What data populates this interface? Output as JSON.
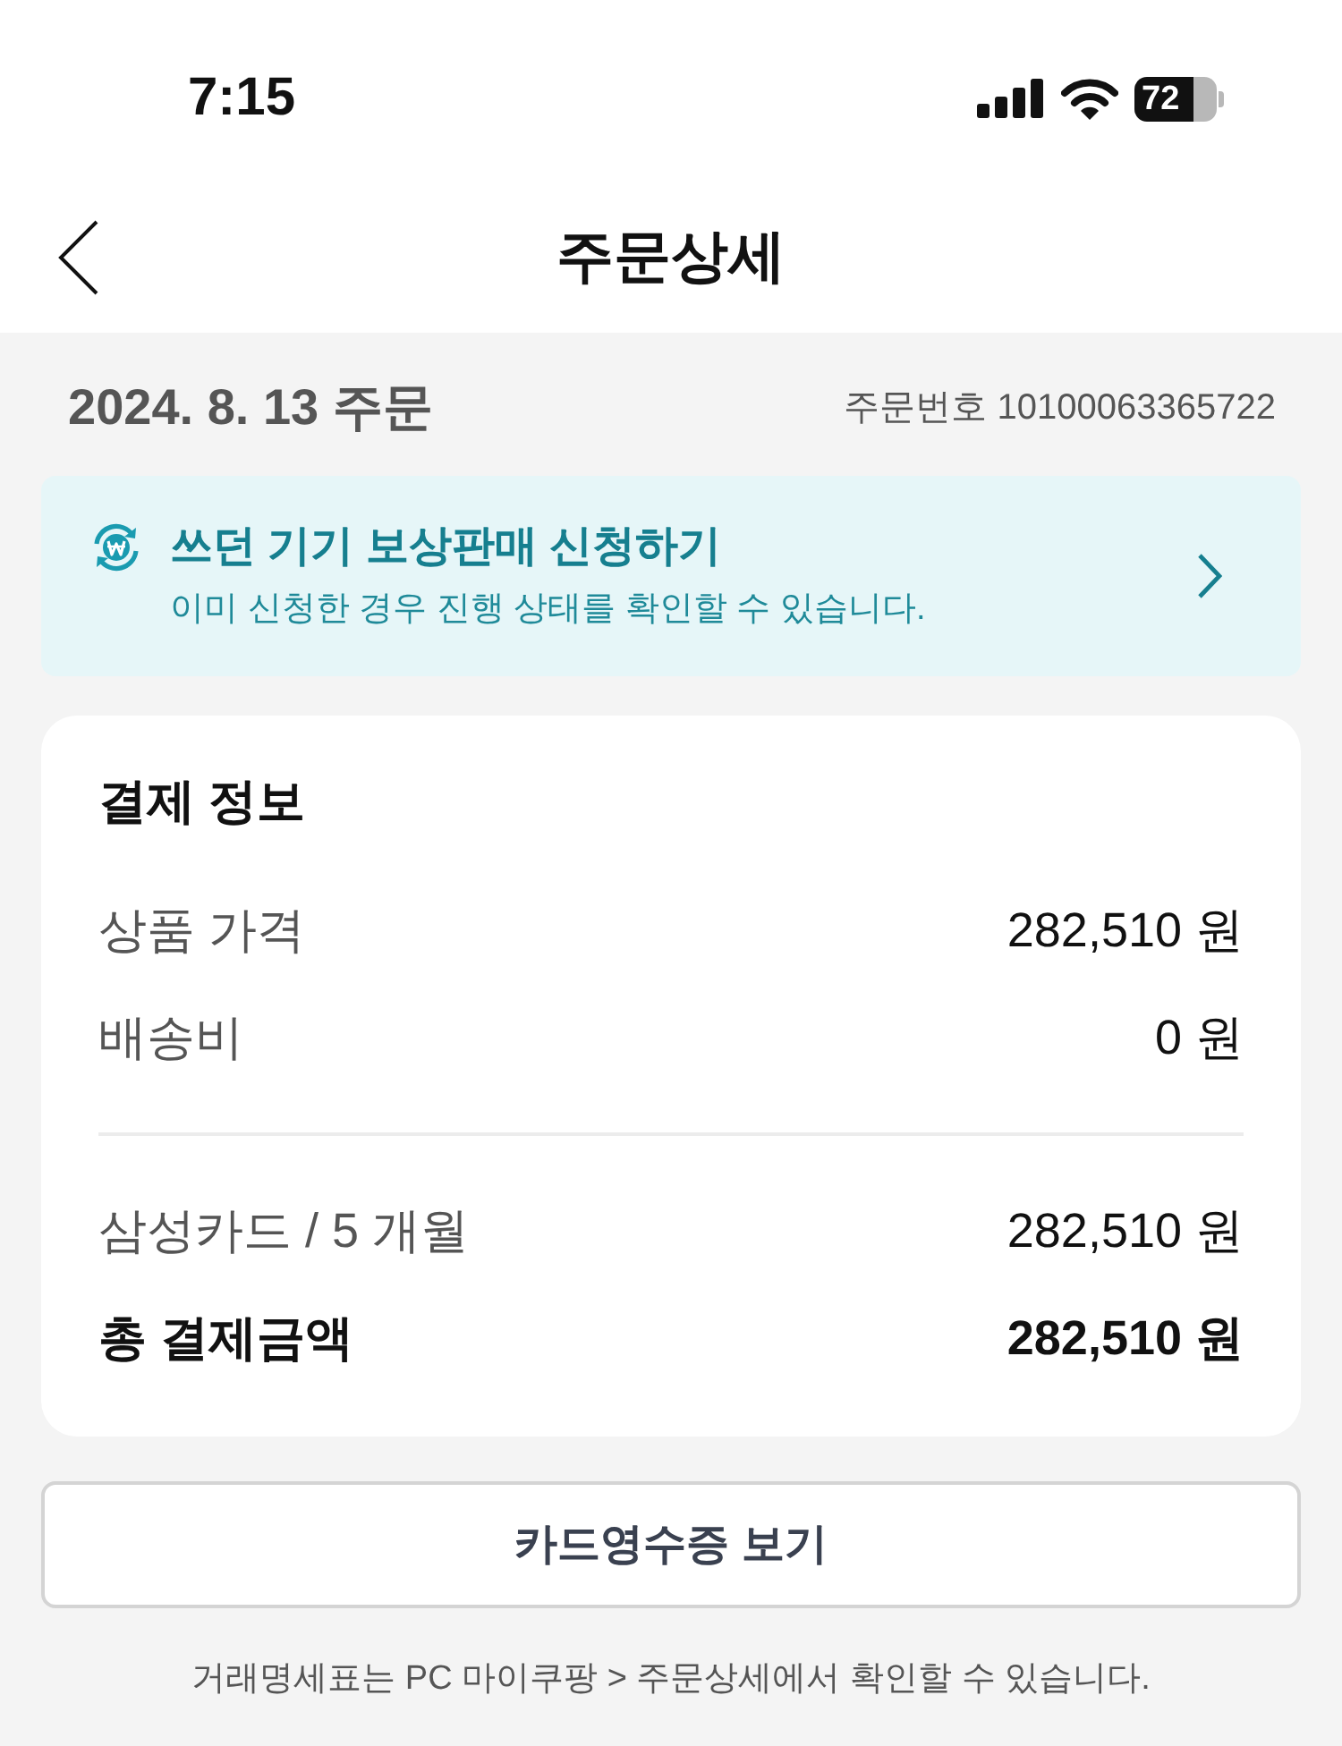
{
  "status_bar": {
    "time": "7:15",
    "battery": "72"
  },
  "header": {
    "title": "주문상세"
  },
  "order": {
    "date": "2024. 8. 13 주문",
    "number_label": "주문번호",
    "number": "10100063365722"
  },
  "trade_in_banner": {
    "title": "쓰던 기기 보상판매 신청하기",
    "subtitle": "이미 신청한 경우 진행 상태를 확인할 수 있습니다."
  },
  "payment": {
    "title": "결제 정보",
    "groups": [
      {
        "rows": [
          {
            "kind": "line",
            "label": "상품 가격",
            "value": "282,510 원"
          },
          {
            "kind": "line",
            "label": "배송비",
            "value": "0 원"
          }
        ]
      },
      {
        "rows": [
          {
            "kind": "line",
            "label": "삼성카드 / 5 개월",
            "value": "282,510 원"
          },
          {
            "kind": "total",
            "label": "총 결제금액",
            "value": "282,510 원"
          }
        ]
      }
    ]
  },
  "receipt_button": {
    "label": "카드영수증 보기"
  },
  "footnote": "거래명세표는 PC 마이쿠팡 > 주문상세에서 확인할 수 있습니다."
}
